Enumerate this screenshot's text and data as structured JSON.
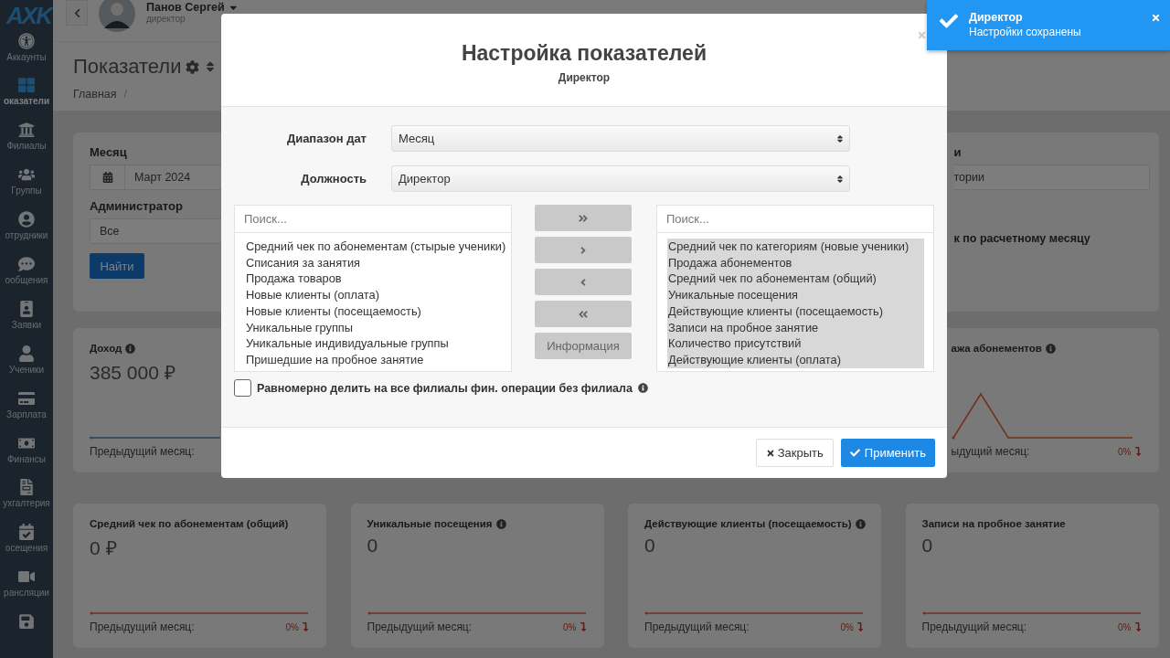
{
  "sidebar": {
    "logo": "AXK",
    "items": [
      {
        "label": "Аккаунты",
        "selected": false
      },
      {
        "label": "оказатели",
        "selected": true
      },
      {
        "label": "Филиалы",
        "selected": false
      },
      {
        "label": "Группы",
        "selected": false
      },
      {
        "label": "отрудники",
        "selected": false
      },
      {
        "label": "ообщения",
        "selected": false
      },
      {
        "label": "Заявки",
        "selected": false
      },
      {
        "label": "Ученики",
        "selected": false
      },
      {
        "label": "Зарплата",
        "selected": false
      },
      {
        "label": "Финансы",
        "selected": false
      },
      {
        "label": "ухгалтерия",
        "selected": false
      },
      {
        "label": "осещения",
        "selected": false
      },
      {
        "label": "рансляции",
        "selected": false
      },
      {
        "selected": false
      }
    ]
  },
  "header": {
    "user_name": "Панов Сергей",
    "user_role": "директор"
  },
  "page": {
    "title": "Показатели",
    "breadcrumb": "Главная",
    "breadcrumb_separator": "/"
  },
  "filters": {
    "month_label": "Месяц",
    "month_value": "Март 2024",
    "admin_label": "Администратор",
    "admin_value": "Все",
    "find_button": "Найти",
    "right_label": "и",
    "right_value": "тории",
    "right_option": "к по расчетному месяцу"
  },
  "metrics_row_1": [
    {
      "title": "Доход",
      "info": true,
      "value": "385 000 ₽",
      "prev_label": "Предыдущий месяц:",
      "kind": "baseline"
    },
    {
      "title": "ажа абонементов",
      "info": true,
      "prev_label": "ыдущий месяц:",
      "percent": "0%",
      "kind": "peak"
    }
  ],
  "metrics_row_2": [
    {
      "title": "Средний чек по абонементам (общий)",
      "info": false,
      "value": "0 ₽",
      "prev_label": "Предыдущий месяц:",
      "percent": "0%",
      "kind": "flat"
    },
    {
      "title": "Уникальные посещения",
      "info": true,
      "value": "0",
      "prev_label": "Предыдущий месяц:",
      "percent": "0%",
      "kind": "flat"
    },
    {
      "title": "Действующие клиенты (посещаемость)",
      "info": true,
      "value": "0",
      "prev_label": "Предыдущий месяц:",
      "percent": "0%",
      "kind": "flat"
    },
    {
      "title": "Записи на пробное занятие",
      "info": false,
      "value": "0",
      "prev_label": "Предыдущий месяц:",
      "percent": "0%",
      "kind": "flat"
    }
  ],
  "modal": {
    "title": "Настройка показателей",
    "subtitle": "Директор",
    "fields": [
      {
        "label": "Диапазон дат",
        "value": "Месяц"
      },
      {
        "label": "Должность",
        "value": "Директор"
      }
    ],
    "left_search_placeholder": "Поиск...",
    "available": [
      {
        "label": "Средний чек по абонементам (стырые ученики)",
        "selected": false
      },
      {
        "label": "Списания за занятия",
        "selected": false
      },
      {
        "label": "Продажа товаров",
        "selected": false
      },
      {
        "label": "Новые клиенты (оплата)",
        "selected": false
      },
      {
        "label": "Новые клиенты (посещаемость)",
        "selected": false
      },
      {
        "label": "Уникальные группы",
        "selected": false
      },
      {
        "label": "Уникальные индивидуальные группы",
        "selected": false
      },
      {
        "label": "Пришедшие на пробное занятие",
        "selected": false
      }
    ],
    "transfer_buttons": [
      {
        "kind": "all-right"
      },
      {
        "kind": "right"
      },
      {
        "kind": "left"
      },
      {
        "kind": "all-left"
      }
    ],
    "info_button": "Информация",
    "right_search_placeholder": "Поиск...",
    "chosen": [
      {
        "label": "Средний чек по категориям (новые ученики)",
        "selected": true
      },
      {
        "label": "Продажа абонементов",
        "selected": true
      },
      {
        "label": "Средний чек по абонементам (общий)",
        "selected": true
      },
      {
        "label": "Уникальные посещения",
        "selected": true
      },
      {
        "label": "Действующие клиенты (посещаемость)",
        "selected": true
      },
      {
        "label": "Записи на пробное занятие",
        "selected": true
      },
      {
        "label": "Количество присутствий",
        "selected": true
      },
      {
        "label": "Действующие клиенты (оплата)",
        "selected": true
      }
    ],
    "split_checkbox": {
      "label": "Равномерно делить на все филиалы фин. операции без филиала",
      "checked": false,
      "info": true
    },
    "close_button": "Закрыть",
    "apply_button": "Применить"
  },
  "toast": {
    "title": "Директор",
    "message": "Настройки сохранены"
  }
}
